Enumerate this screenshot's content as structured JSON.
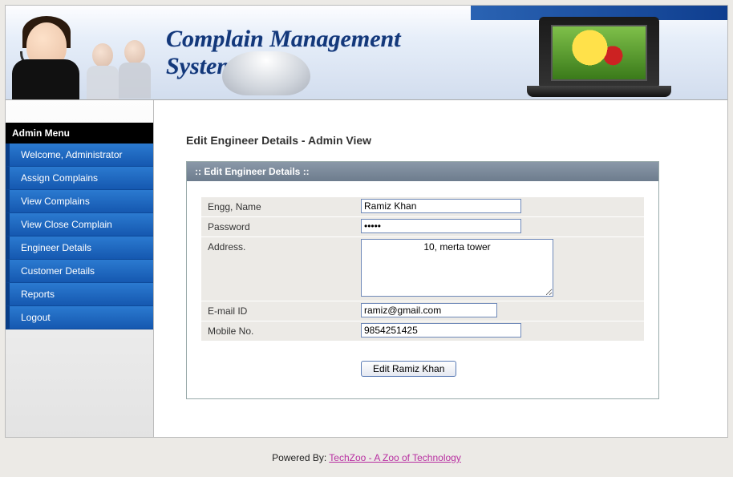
{
  "banner": {
    "title": "Complain Management System"
  },
  "sidebar": {
    "heading": "Admin Menu",
    "items": [
      {
        "label": "Welcome, Administrator"
      },
      {
        "label": "Assign Complains"
      },
      {
        "label": "View Complains"
      },
      {
        "label": "View Close Complain"
      },
      {
        "label": "Engineer Details"
      },
      {
        "label": "Customer Details"
      },
      {
        "label": "Reports"
      },
      {
        "label": "Logout"
      }
    ]
  },
  "page": {
    "title": "Edit Engineer Details - Admin View",
    "panel_header": ":: Edit Engineer Details ::"
  },
  "form": {
    "labels": {
      "name": "Engg, Name",
      "password": "Password",
      "address": "Address.",
      "email": "E-mail ID",
      "mobile": "Mobile No."
    },
    "values": {
      "name": "Ramiz Khan",
      "password": "•••••",
      "address": "10, merta tower",
      "email": "ramiz@gmail.com",
      "mobile": "9854251425"
    },
    "submit_label": "Edit Ramiz Khan"
  },
  "footer": {
    "powered_label": "Powered By: ",
    "link_text": "TechZoo - A Zoo of Technology"
  }
}
